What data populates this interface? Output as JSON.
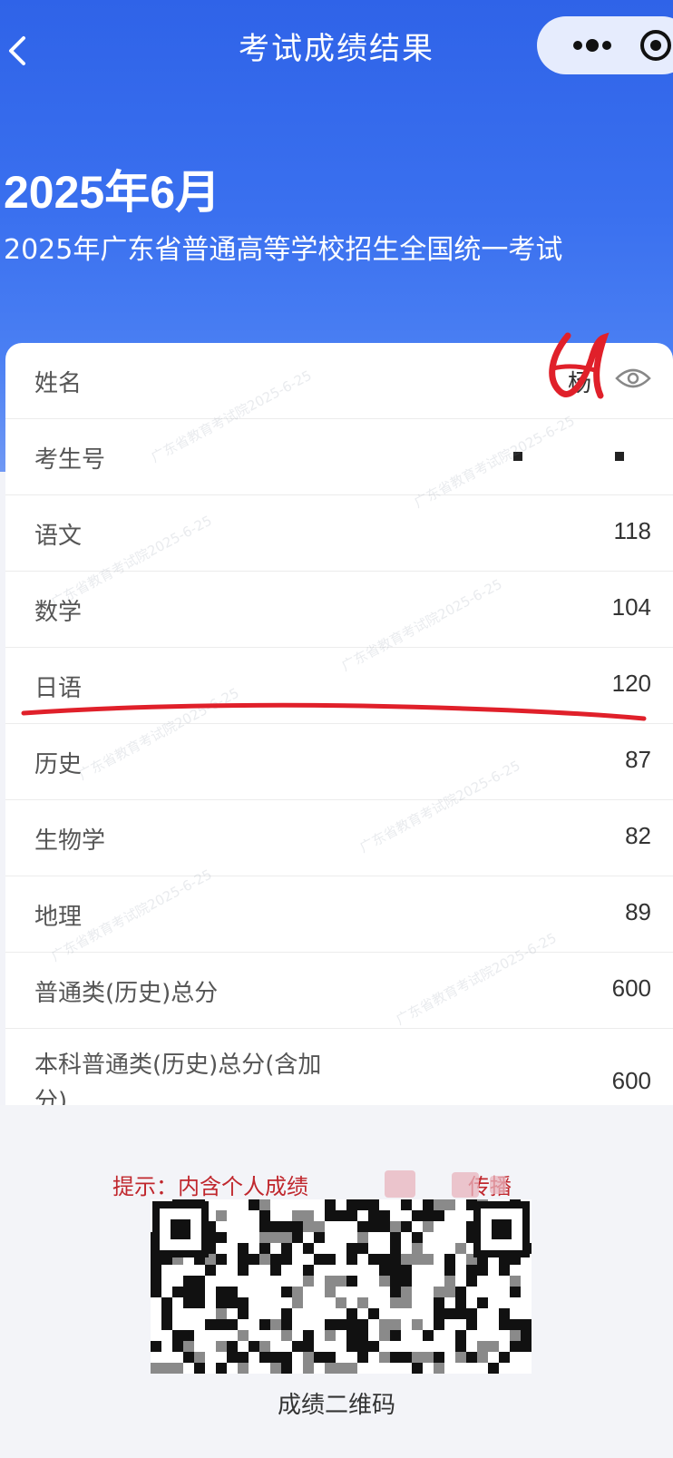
{
  "navbar": {
    "title": "考试成绩结果",
    "back_icon": "chevron-left-icon",
    "more_icon": "more-dots-icon",
    "target_icon": "target-icon"
  },
  "exam": {
    "date": "2025年6月",
    "name": "2025年广东省普通高等学校招生全国统一考试"
  },
  "rows": [
    {
      "label": "姓名",
      "value": "杨"
    },
    {
      "label": "考生号",
      "value": ""
    },
    {
      "label": "语文",
      "value": "118"
    },
    {
      "label": "数学",
      "value": "104"
    },
    {
      "label": "日语",
      "value": "120"
    },
    {
      "label": "历史",
      "value": "87"
    },
    {
      "label": "生物学",
      "value": "82"
    },
    {
      "label": "地理",
      "value": "89"
    },
    {
      "label": "普通类(历史)总分",
      "value": "600"
    },
    {
      "label": "本科普通类(历史)总分(含加分)",
      "value": "600"
    }
  ],
  "tip": "提示：内含个人成绩",
  "tip_tail": "传播",
  "qr_caption": "成绩二维码",
  "watermark": "广东省教育考试院2025-6-25",
  "colors": {
    "hero": "#2f63e8",
    "annotation_red": "#e0202a",
    "tip_red": "#c0272d"
  }
}
